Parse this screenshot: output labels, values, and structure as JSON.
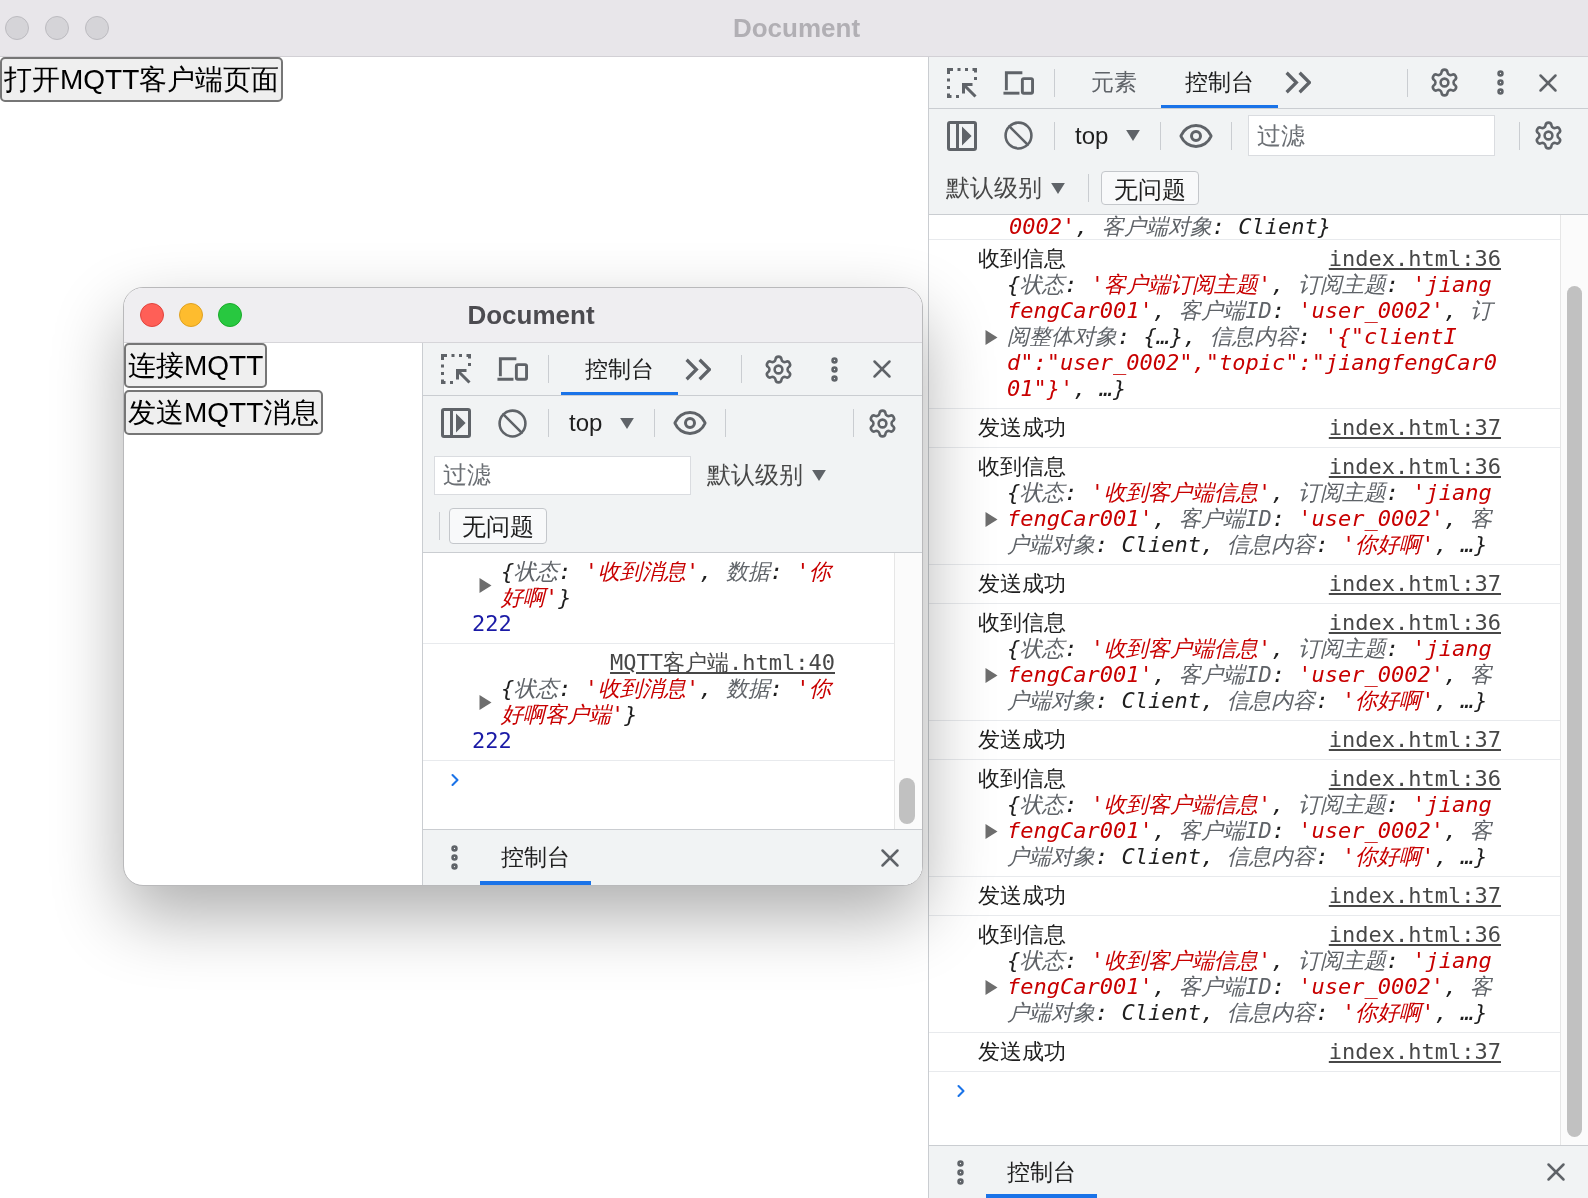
{
  "window": {
    "title": "Document",
    "focused": false
  },
  "page": {
    "buttons": [
      "打开MQTT客户端页面"
    ]
  },
  "devtools": {
    "tabs": [
      {
        "label": "元素",
        "selected": false
      },
      {
        "label": "控制台",
        "selected": true
      }
    ],
    "context": "top",
    "filter": {
      "placeholder": "过滤"
    },
    "log_levels": "默认级别",
    "issues": "无问题",
    "messages": [
      {
        "kind": "tail",
        "preview": [
          {
            "kind": "string",
            "text": "0002'"
          },
          {
            "kind": "plain",
            "text": ", "
          },
          {
            "kind": "key",
            "text": "客户端对象"
          },
          {
            "kind": "plain",
            "text": ": Client}"
          }
        ]
      },
      {
        "kind": "object",
        "text": "收到信息",
        "source": "index.html:36",
        "expanded": false,
        "preview": [
          {
            "kind": "plain",
            "text": "{"
          },
          {
            "kind": "key",
            "text": "状态"
          },
          {
            "kind": "plain",
            "text": ": "
          },
          {
            "kind": "string",
            "text": "'客户端订阅主题'"
          },
          {
            "kind": "plain",
            "text": ", "
          },
          {
            "kind": "key",
            "text": "订阅主题"
          },
          {
            "kind": "plain",
            "text": ": "
          },
          {
            "kind": "string",
            "text": "'jiangfengCar001'"
          },
          {
            "kind": "plain",
            "text": ", "
          },
          {
            "kind": "key",
            "text": "客户端ID"
          },
          {
            "kind": "plain",
            "text": ": "
          },
          {
            "kind": "string",
            "text": "'user_0002'"
          },
          {
            "kind": "plain",
            "text": ", "
          },
          {
            "kind": "key",
            "text": "订阅整体对象"
          },
          {
            "kind": "plain",
            "text": ": {…}, "
          },
          {
            "kind": "key",
            "text": "信息内容"
          },
          {
            "kind": "plain",
            "text": ": "
          },
          {
            "kind": "string",
            "text": "'{\"clientId\":\"user_0002\",\"topic\":\"jiangfengCar001\"}'"
          },
          {
            "kind": "plain",
            "text": ", …}"
          }
        ]
      },
      {
        "kind": "text",
        "text": "发送成功",
        "source": "index.html:37"
      },
      {
        "kind": "object",
        "text": "收到信息",
        "source": "index.html:36",
        "expanded": false,
        "preview": [
          {
            "kind": "plain",
            "text": "{"
          },
          {
            "kind": "key",
            "text": "状态"
          },
          {
            "kind": "plain",
            "text": ": "
          },
          {
            "kind": "string",
            "text": "'收到客户端信息'"
          },
          {
            "kind": "plain",
            "text": ", "
          },
          {
            "kind": "key",
            "text": "订阅主题"
          },
          {
            "kind": "plain",
            "text": ": "
          },
          {
            "kind": "string",
            "text": "'jiangfengCar001'"
          },
          {
            "kind": "plain",
            "text": ", "
          },
          {
            "kind": "key",
            "text": "客户端ID"
          },
          {
            "kind": "plain",
            "text": ": "
          },
          {
            "kind": "string",
            "text": "'user_0002'"
          },
          {
            "kind": "plain",
            "text": ", "
          },
          {
            "kind": "key",
            "text": "客户端对象"
          },
          {
            "kind": "plain",
            "text": ": Client, "
          },
          {
            "kind": "key",
            "text": "信息内容"
          },
          {
            "kind": "plain",
            "text": ": "
          },
          {
            "kind": "string",
            "text": "'你好啊'"
          },
          {
            "kind": "plain",
            "text": ", …}"
          }
        ]
      },
      {
        "kind": "text",
        "text": "发送成功",
        "source": "index.html:37"
      },
      {
        "kind": "object",
        "text": "收到信息",
        "source": "index.html:36",
        "expanded": false,
        "preview": [
          {
            "kind": "plain",
            "text": "{"
          },
          {
            "kind": "key",
            "text": "状态"
          },
          {
            "kind": "plain",
            "text": ": "
          },
          {
            "kind": "string",
            "text": "'收到客户端信息'"
          },
          {
            "kind": "plain",
            "text": ", "
          },
          {
            "kind": "key",
            "text": "订阅主题"
          },
          {
            "kind": "plain",
            "text": ": "
          },
          {
            "kind": "string",
            "text": "'jiangfengCar001'"
          },
          {
            "kind": "plain",
            "text": ", "
          },
          {
            "kind": "key",
            "text": "客户端ID"
          },
          {
            "kind": "plain",
            "text": ": "
          },
          {
            "kind": "string",
            "text": "'user_0002'"
          },
          {
            "kind": "plain",
            "text": ", "
          },
          {
            "kind": "key",
            "text": "客户端对象"
          },
          {
            "kind": "plain",
            "text": ": Client, "
          },
          {
            "kind": "key",
            "text": "信息内容"
          },
          {
            "kind": "plain",
            "text": ": "
          },
          {
            "kind": "string",
            "text": "'你好啊'"
          },
          {
            "kind": "plain",
            "text": ", …}"
          }
        ]
      },
      {
        "kind": "text",
        "text": "发送成功",
        "source": "index.html:37"
      },
      {
        "kind": "object",
        "text": "收到信息",
        "source": "index.html:36",
        "expanded": false,
        "preview": [
          {
            "kind": "plain",
            "text": "{"
          },
          {
            "kind": "key",
            "text": "状态"
          },
          {
            "kind": "plain",
            "text": ": "
          },
          {
            "kind": "string",
            "text": "'收到客户端信息'"
          },
          {
            "kind": "plain",
            "text": ", "
          },
          {
            "kind": "key",
            "text": "订阅主题"
          },
          {
            "kind": "plain",
            "text": ": "
          },
          {
            "kind": "string",
            "text": "'jiangfengCar001'"
          },
          {
            "kind": "plain",
            "text": ", "
          },
          {
            "kind": "key",
            "text": "客户端ID"
          },
          {
            "kind": "plain",
            "text": ": "
          },
          {
            "kind": "string",
            "text": "'user_0002'"
          },
          {
            "kind": "plain",
            "text": ", "
          },
          {
            "kind": "key",
            "text": "客户端对象"
          },
          {
            "kind": "plain",
            "text": ": Client, "
          },
          {
            "kind": "key",
            "text": "信息内容"
          },
          {
            "kind": "plain",
            "text": ": "
          },
          {
            "kind": "string",
            "text": "'你好啊'"
          },
          {
            "kind": "plain",
            "text": ", …}"
          }
        ]
      },
      {
        "kind": "text",
        "text": "发送成功",
        "source": "index.html:37"
      },
      {
        "kind": "object",
        "text": "收到信息",
        "source": "index.html:36",
        "expanded": false,
        "preview": [
          {
            "kind": "plain",
            "text": "{"
          },
          {
            "kind": "key",
            "text": "状态"
          },
          {
            "kind": "plain",
            "text": ": "
          },
          {
            "kind": "string",
            "text": "'收到客户端信息'"
          },
          {
            "kind": "plain",
            "text": ", "
          },
          {
            "kind": "key",
            "text": "订阅主题"
          },
          {
            "kind": "plain",
            "text": ": "
          },
          {
            "kind": "string",
            "text": "'jiangfengCar001'"
          },
          {
            "kind": "plain",
            "text": ", "
          },
          {
            "kind": "key",
            "text": "客户端ID"
          },
          {
            "kind": "plain",
            "text": ": "
          },
          {
            "kind": "string",
            "text": "'user_0002'"
          },
          {
            "kind": "plain",
            "text": ", "
          },
          {
            "kind": "key",
            "text": "客户端对象"
          },
          {
            "kind": "plain",
            "text": ": Client, "
          },
          {
            "kind": "key",
            "text": "信息内容"
          },
          {
            "kind": "plain",
            "text": ": "
          },
          {
            "kind": "string",
            "text": "'你好啊'"
          },
          {
            "kind": "plain",
            "text": ", …}"
          }
        ]
      },
      {
        "kind": "text",
        "text": "发送成功",
        "source": "index.html:37"
      }
    ],
    "drawer": {
      "tabs": [
        {
          "label": "控制台",
          "selected": true
        }
      ]
    }
  },
  "popup_window": {
    "title": "Document",
    "focused": true,
    "page": {
      "buttons": [
        "连接MQTT",
        "发送MQTT消息"
      ]
    },
    "devtools": {
      "tabs": [
        {
          "label": "控制台",
          "selected": true
        }
      ],
      "context": "top",
      "filter": {
        "placeholder": "过滤"
      },
      "log_levels": "默认级别",
      "issues": "无问题",
      "messages": [
        {
          "kind": "object",
          "expanded": false,
          "preview": [
            {
              "kind": "plain",
              "text": "{"
            },
            {
              "kind": "key",
              "text": "状态"
            },
            {
              "kind": "plain",
              "text": ": "
            },
            {
              "kind": "string",
              "text": "'收到消息'"
            },
            {
              "kind": "plain",
              "text": ", "
            },
            {
              "kind": "key",
              "text": "数据"
            },
            {
              "kind": "plain",
              "text": ": "
            },
            {
              "kind": "string",
              "text": "'你好啊'"
            },
            {
              "kind": "plain",
              "text": "}"
            }
          ],
          "number": "222"
        },
        {
          "kind": "object",
          "source": "MQTT客户端.html:40",
          "expanded": false,
          "preview": [
            {
              "kind": "plain",
              "text": "{"
            },
            {
              "kind": "key",
              "text": "状态"
            },
            {
              "kind": "plain",
              "text": ": "
            },
            {
              "kind": "string",
              "text": "'收到消息'"
            },
            {
              "kind": "plain",
              "text": ", "
            },
            {
              "kind": "key",
              "text": "数据"
            },
            {
              "kind": "plain",
              "text": ": "
            },
            {
              "kind": "string",
              "text": "'你好啊客户端'"
            },
            {
              "kind": "plain",
              "text": "}"
            }
          ],
          "number": "222"
        }
      ],
      "drawer": {
        "tabs": [
          {
            "label": "控制台",
            "selected": true
          }
        ]
      }
    }
  }
}
